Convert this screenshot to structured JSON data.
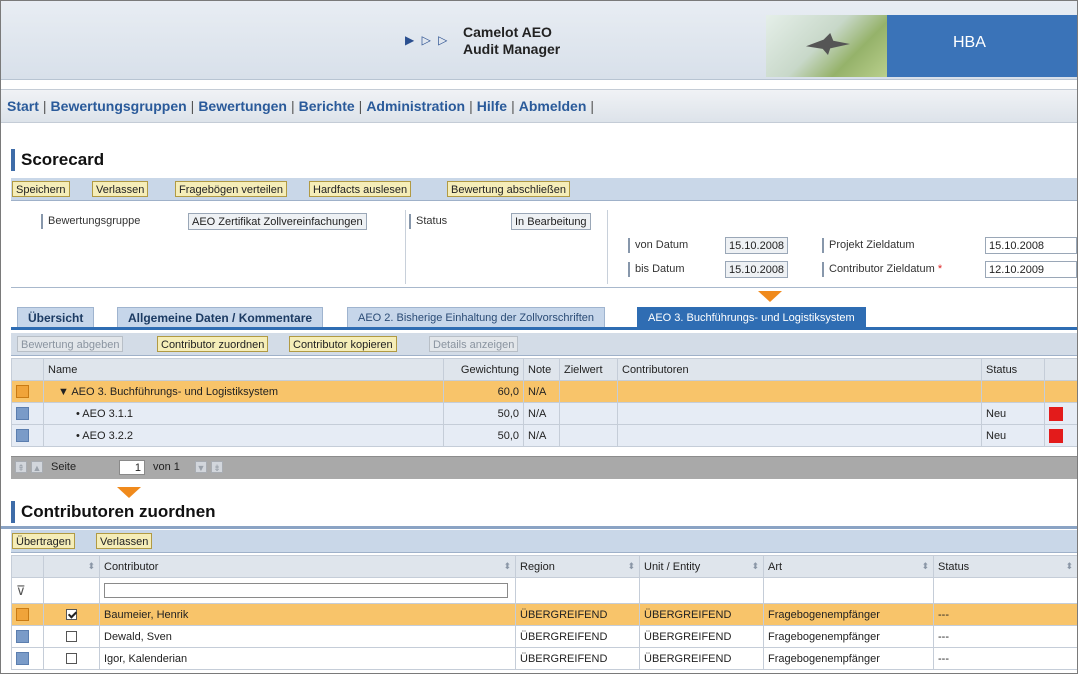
{
  "header": {
    "app_name_line1": "Camelot AEO",
    "app_name_line2": "Audit Manager",
    "brand": "HBA",
    "arrows": "▶ ▷ ▷"
  },
  "nav": {
    "items": [
      "Start",
      "Bewertungsgruppen",
      "Bewertungen",
      "Berichte",
      "Administration",
      "Hilfe",
      "Abmelden"
    ],
    "trailing_sep": "|"
  },
  "scorecard": {
    "title": "Scorecard",
    "toolbar": {
      "speichern": "Speichern",
      "verlassen": "Verlassen",
      "frageboegen": "Fragebögen verteilen",
      "hardfacts": "Hardfacts auslesen",
      "abschliessen": "Bewertung abschließen"
    },
    "form": {
      "bewertungsgruppe_label": "Bewertungsgruppe",
      "bewertungsgruppe_value": "AEO Zertifikat Zollvereinfachungen",
      "status_label": "Status",
      "status_value": "In Bearbeitung",
      "von_datum_label": "von Datum",
      "von_datum_value": "15.10.2008",
      "bis_datum_label": "bis Datum",
      "bis_datum_value": "15.10.2008",
      "projekt_zieldatum_label": "Projekt Zieldatum",
      "projekt_zieldatum_value": "15.10.2008",
      "contributor_zieldatum_label": "Contributor Zieldatum",
      "contributor_zieldatum_required": "*",
      "contributor_zieldatum_value": "12.10.2009"
    },
    "tabs": [
      "Übersicht",
      "Allgemeine Daten / Kommentare",
      "AEO 2. Bisherige Einhaltung der Zollvorschriften",
      "AEO 3. Buchführungs- und Logistiksystem"
    ],
    "active_tab": "AEO 3. Buchführungs- und Logistiksystem",
    "grid_toolbar": {
      "bewertung_abgeben": "Bewertung abgeben",
      "contributor_zuordnen": "Contributor zuordnen",
      "contributor_kopieren": "Contributor kopieren",
      "details_anzeigen": "Details anzeigen"
    },
    "grid": {
      "columns": [
        "Name",
        "Gewichtung",
        "Note",
        "Zielwert",
        "Contributoren",
        "Status"
      ],
      "rows": [
        {
          "name": "▼ AEO 3. Buchführungs- und Logistiksystem",
          "gewichtung": "60,0",
          "note": "N/A",
          "zielwert": "",
          "contributoren": "",
          "status": ""
        },
        {
          "name": "• AEO 3.1.1",
          "gewichtung": "50,0",
          "note": "N/A",
          "zielwert": "",
          "contributoren": "",
          "status": "Neu"
        },
        {
          "name": "• AEO 3.2.2",
          "gewichtung": "50,0",
          "note": "N/A",
          "zielwert": "",
          "contributoren": "",
          "status": "Neu"
        }
      ]
    },
    "pager": {
      "seite_label": "Seite",
      "page": "1",
      "von_label": "von 1"
    }
  },
  "contributors": {
    "title": "Contributoren zuordnen",
    "toolbar": {
      "uebertragen": "Übertragen",
      "verlassen": "Verlassen"
    },
    "columns": [
      "Contributor",
      "Region",
      "Unit / Entity",
      "Art",
      "Status"
    ],
    "rows": [
      {
        "checked": true,
        "name": "Baumeier, Henrik",
        "region": "ÜBERGREIFEND",
        "unit": "ÜBERGREIFEND",
        "art": "Fragebogenempfänger",
        "status": "---"
      },
      {
        "checked": false,
        "name": "Dewald, Sven",
        "region": "ÜBERGREIFEND",
        "unit": "ÜBERGREIFEND",
        "art": "Fragebogenempfänger",
        "status": "---"
      },
      {
        "checked": false,
        "name": "Igor, Kalenderian",
        "region": "ÜBERGREIFEND",
        "unit": "ÜBERGREIFEND",
        "art": "Fragebogenempfänger",
        "status": "---"
      }
    ]
  },
  "colors": {
    "accent_blue": "#2f6db3",
    "button_yellow": "#f5edb8",
    "highlight_orange": "#f8c46a",
    "status_red": "#e31b1b"
  }
}
